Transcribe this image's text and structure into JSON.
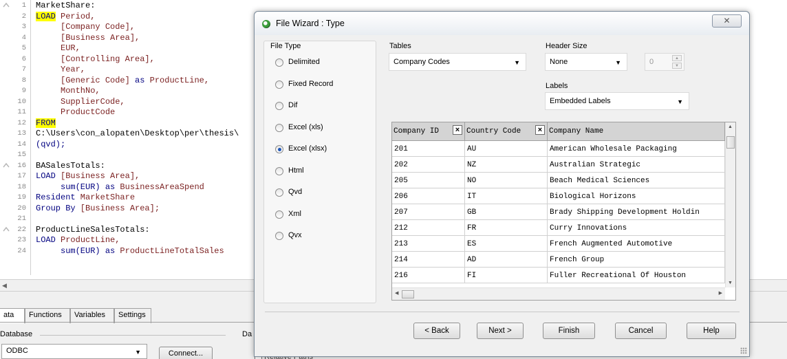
{
  "editor": {
    "lines": [
      {
        "n": "1",
        "segments": [
          {
            "t": "MarketShare:",
            "c": "str"
          }
        ]
      },
      {
        "n": "2",
        "segments": [
          {
            "t": "LOAD",
            "c": "kw"
          },
          {
            "t": " Period,",
            "c": "fld"
          }
        ]
      },
      {
        "n": "3",
        "segments": [
          {
            "t": "     [Company Code],",
            "c": "fld"
          }
        ]
      },
      {
        "n": "4",
        "segments": [
          {
            "t": "     [Business Area],",
            "c": "fld"
          }
        ]
      },
      {
        "n": "5",
        "segments": [
          {
            "t": "     EUR,",
            "c": "fld"
          }
        ]
      },
      {
        "n": "6",
        "segments": [
          {
            "t": "     [Controlling Area],",
            "c": "fld"
          }
        ]
      },
      {
        "n": "7",
        "segments": [
          {
            "t": "     Year,",
            "c": "fld"
          }
        ]
      },
      {
        "n": "8",
        "segments": [
          {
            "t": "     [Generic Code] ",
            "c": "fld"
          },
          {
            "t": "as",
            "c": "kw2"
          },
          {
            "t": " ProductLine,",
            "c": "fld"
          }
        ]
      },
      {
        "n": "9",
        "segments": [
          {
            "t": "     MonthNo,",
            "c": "fld"
          }
        ]
      },
      {
        "n": "10",
        "segments": [
          {
            "t": "     SupplierCode,",
            "c": "fld"
          }
        ]
      },
      {
        "n": "11",
        "segments": [
          {
            "t": "     ProductCode",
            "c": "fld"
          }
        ]
      },
      {
        "n": "12",
        "segments": [
          {
            "t": "FROM",
            "c": "kw"
          }
        ]
      },
      {
        "n": "13",
        "segments": [
          {
            "t": "C:\\Users\\con_alopaten\\Desktop\\per\\thesis\\",
            "c": "str"
          }
        ]
      },
      {
        "n": "14",
        "segments": [
          {
            "t": "(qvd);",
            "c": "kw2"
          }
        ]
      },
      {
        "n": "15",
        "segments": []
      },
      {
        "n": "16",
        "segments": [
          {
            "t": "BASalesTotals:",
            "c": "str"
          }
        ]
      },
      {
        "n": "17",
        "segments": [
          {
            "t": "LOAD",
            "c": "kw2"
          },
          {
            "t": " [Business Area],",
            "c": "fld"
          }
        ]
      },
      {
        "n": "18",
        "segments": [
          {
            "t": "     sum(EUR) ",
            "c": "kw2"
          },
          {
            "t": "as",
            "c": "kw2"
          },
          {
            "t": " BusinessAreaSpend",
            "c": "fld"
          }
        ]
      },
      {
        "n": "19",
        "segments": [
          {
            "t": "Resident",
            "c": "kw2"
          },
          {
            "t": " MarketShare",
            "c": "fld"
          }
        ]
      },
      {
        "n": "20",
        "segments": [
          {
            "t": "Group By",
            "c": "kw2"
          },
          {
            "t": " [Business Area];",
            "c": "fld"
          }
        ]
      },
      {
        "n": "21",
        "segments": []
      },
      {
        "n": "22",
        "segments": [
          {
            "t": "ProductLineSalesTotals:",
            "c": "str"
          }
        ]
      },
      {
        "n": "23",
        "segments": [
          {
            "t": "LOAD",
            "c": "kw2"
          },
          {
            "t": " ProductLine,",
            "c": "fld"
          }
        ]
      },
      {
        "n": "24",
        "segments": [
          {
            "t": "     sum(EUR) ",
            "c": "kw2"
          },
          {
            "t": "as",
            "c": "kw2"
          },
          {
            "t": " ProductLineTotalSales",
            "c": "fld"
          }
        ]
      }
    ]
  },
  "bottom_panel": {
    "tabs": [
      "ata",
      "Functions",
      "Variables",
      "Settings"
    ],
    "database_label": "Database",
    "database_value": "ODBC",
    "connect_label": "Connect...",
    "data_fragment_label": "Da",
    "relative_paths_label": "Relative Paths"
  },
  "dialog": {
    "title": "File Wizard : Type",
    "close_glyph": "✕",
    "file_type_label": "File Type",
    "file_types": [
      "Delimited",
      "Fixed Record",
      "Dif",
      "Excel (xls)",
      "Excel (xlsx)",
      "Html",
      "Qvd",
      "Xml",
      "Qvx"
    ],
    "selected_file_type": "Excel (xlsx)",
    "tables_label": "Tables",
    "tables_value": "Company Codes",
    "header_size_label": "Header Size",
    "header_size_value": "None",
    "header_size_number": "0",
    "labels_label": "Labels",
    "labels_value": "Embedded Labels",
    "grid": {
      "columns": [
        "Company ID",
        "Country Code",
        "Company Name"
      ],
      "rows": [
        [
          "201",
          "AU",
          "American Wholesale Packaging"
        ],
        [
          "202",
          "NZ",
          "Australian Strategic"
        ],
        [
          "205",
          "NO",
          "Beach Medical Sciences"
        ],
        [
          "206",
          "IT",
          "Biological Horizons"
        ],
        [
          "207",
          "GB",
          "Brady Shipping Development Holdin"
        ],
        [
          "212",
          "FR",
          "Curry Innovations"
        ],
        [
          "213",
          "ES",
          "French Augmented Automotive"
        ],
        [
          "214",
          "AD",
          "French Group"
        ],
        [
          "216",
          "FI",
          "Fuller Recreational Of Houston"
        ]
      ]
    },
    "buttons": {
      "back": "< Back",
      "next": "Next >",
      "finish": "Finish",
      "cancel": "Cancel",
      "help": "Help"
    }
  }
}
